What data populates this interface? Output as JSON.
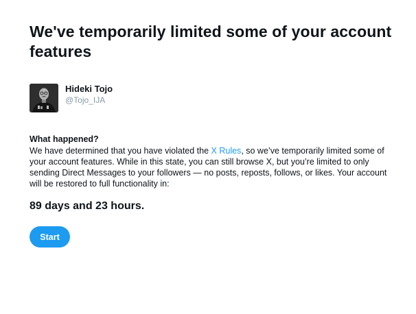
{
  "page": {
    "title": "We've temporarily limited some of your account features"
  },
  "account": {
    "display_name": "Hideki Tojo",
    "handle": "@Tojo_IJA"
  },
  "notice": {
    "heading": "What happened?",
    "text_before_link": "We have determined that you have violated the ",
    "link_label": "X Rules",
    "text_after_link": ", so we’ve temporarily limited some of your account features. While in this state, you can still browse X, but you’re limited to only sending Direct Messages to your followers — no posts, reposts, follows, or likes. Your account will be restored to full functionality in:",
    "countdown": "89 days and 23 hours."
  },
  "actions": {
    "start_label": "Start"
  },
  "colors": {
    "accent": "#1d9bf0",
    "text": "#0f1419",
    "muted": "#8899a6"
  }
}
